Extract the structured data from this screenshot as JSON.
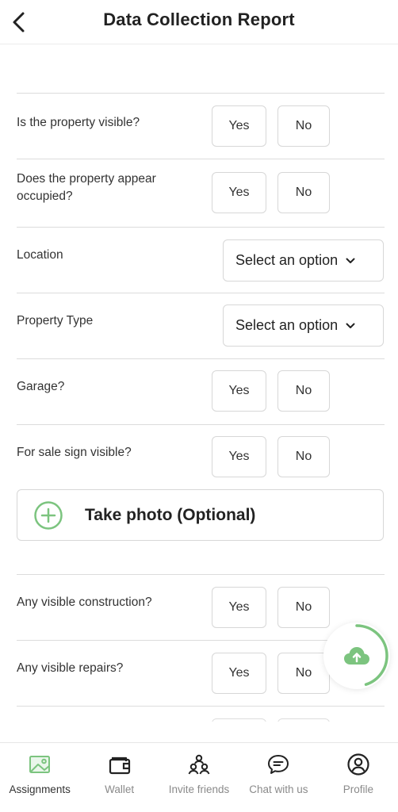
{
  "header": {
    "title": "Data Collection Report"
  },
  "form": {
    "questions": [
      {
        "label": "Is the property visible?",
        "yes": "Yes",
        "no": "No"
      },
      {
        "label": "Does the property appear occupied?",
        "yes": "Yes",
        "no": "No"
      },
      {
        "label": "Location",
        "value": "Select an option"
      },
      {
        "label": "Property Type",
        "value": "Select an option"
      },
      {
        "label": "Garage?",
        "yes": "Yes",
        "no": "No"
      },
      {
        "label": "For sale sign visible?",
        "yes": "Yes",
        "no": "No"
      },
      {
        "label": "Any visible construction?",
        "yes": "Yes",
        "no": "No"
      },
      {
        "label": "Any visible repairs?",
        "yes": "Yes",
        "no": "No"
      }
    ],
    "photo_button": "Take photo (Optional)"
  },
  "upload": {
    "icon": "cloud-upload-icon",
    "progress": 0.45
  },
  "tabs": [
    {
      "label": "Assignments",
      "icon": "assignments-icon",
      "active": true
    },
    {
      "label": "Wallet",
      "icon": "wallet-icon"
    },
    {
      "label": "Invite friends",
      "icon": "invite-friends-icon"
    },
    {
      "label": "Chat with us",
      "icon": "chat-icon"
    },
    {
      "label": "Profile",
      "icon": "profile-icon"
    }
  ],
  "colors": {
    "accent": "#7cc47f",
    "border": "#d7d7d7",
    "text": "#333333",
    "muted": "#8a8a8a"
  }
}
